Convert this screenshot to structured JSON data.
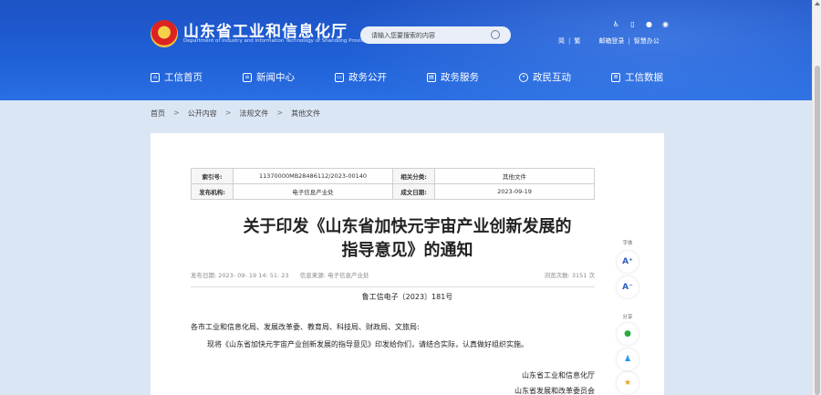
{
  "header": {
    "title": "山东省工业和信息化厅",
    "subtitle": "Department of Industry and Information Technology of Shandong Province",
    "search_placeholder": "请输入您要搜索的内容",
    "top_links": [
      "简",
      "繁",
      "邮箱登录",
      "智慧办公"
    ]
  },
  "nav": {
    "items": [
      "工信首页",
      "新闻中心",
      "政务公开",
      "政务服务",
      "政民互动",
      "工信数据"
    ]
  },
  "breadcrumb": [
    "首页",
    "公开内容",
    "法规文件",
    "其他文件"
  ],
  "meta": {
    "index_label": "索引号:",
    "index_value": "11370000MB28486112/2023-00140",
    "category_label": "相关分类:",
    "category_value": "其他文件",
    "issuer_label": "发布机构:",
    "issuer_value": "电子信息产业处",
    "date_label": "成文日期:",
    "date_value": "2023-09-19"
  },
  "document": {
    "title_line1": "关于印发《山东省加快元宇宙产业创新发展的",
    "title_line2": "指导意见》的通知",
    "publish_time": "发布日期: 2023- 09- 19 14: 51: 23",
    "source": "信息来源: 电子信息产业处",
    "views": "浏览次数:   3151   次",
    "doc_number": "鲁工信电子〔2023〕181号",
    "para1": "各市工业和信息化局、发展改革委、教育局、科技局、财政局、文旅局:",
    "para2": "现将《山东省加快元宇宙产业创新发展的指导意见》印发给你们，请结合实际，认真做好组织实施。",
    "sign1": "山东省工业和信息化厅",
    "sign2": "山东省发展和改革委员会"
  },
  "tools": {
    "font_label": "字体",
    "share_label": "分享",
    "font_up": "A⁺",
    "font_down": "A⁻"
  }
}
